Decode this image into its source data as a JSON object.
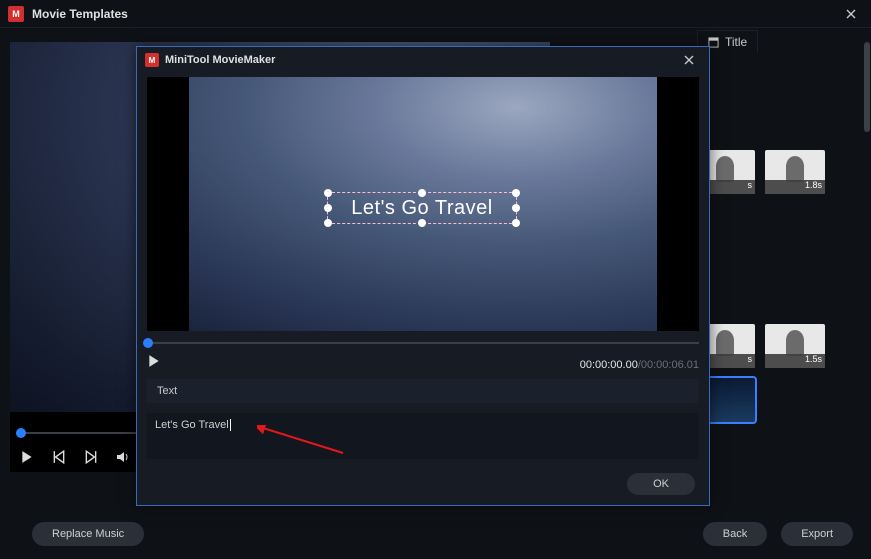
{
  "window": {
    "title": "Movie Templates"
  },
  "rightPane": {
    "tab": "Title",
    "thumbs": [
      {
        "duration": "s"
      },
      {
        "duration": "1.8s"
      },
      {
        "duration": "s"
      },
      {
        "duration": "1.5s"
      },
      {
        "duration": ""
      },
      {
        "duration": ""
      }
    ]
  },
  "footer": {
    "replaceMusic": "Replace Music",
    "back": "Back",
    "export": "Export"
  },
  "modal": {
    "title": "MiniTool MovieMaker",
    "overlayText": "Let's Go Travel",
    "timecode": {
      "current": "00:00:00.00",
      "total": "/00:00:06.01"
    },
    "tab": "Text",
    "textInput": "Let's Go Travel",
    "ok": "OK"
  }
}
